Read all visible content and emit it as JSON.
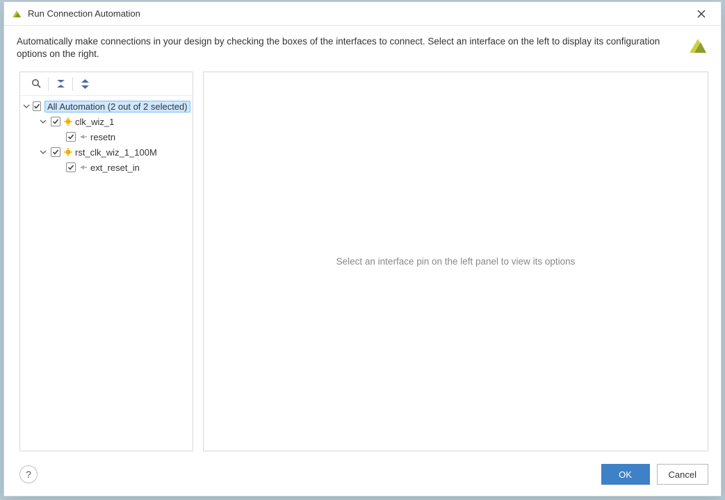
{
  "title": "Run Connection Automation",
  "description": "Automatically make connections in your design by checking the boxes of the interfaces to connect. Select an interface on the left to display its configuration options on the right.",
  "toolbar": {
    "search_tip": "Search",
    "collapse_tip": "Collapse all",
    "expand_tip": "Expand all"
  },
  "tree": {
    "root_label": "All Automation (2 out of 2 selected)",
    "items": [
      {
        "label": "clk_wiz_1",
        "pins": [
          {
            "label": "resetn"
          }
        ]
      },
      {
        "label": "rst_clk_wiz_1_100M",
        "pins": [
          {
            "label": "ext_reset_in"
          }
        ]
      }
    ]
  },
  "right_placeholder": "Select an interface pin on the left panel to view its options",
  "buttons": {
    "ok": "OK",
    "cancel": "Cancel",
    "help": "?"
  }
}
